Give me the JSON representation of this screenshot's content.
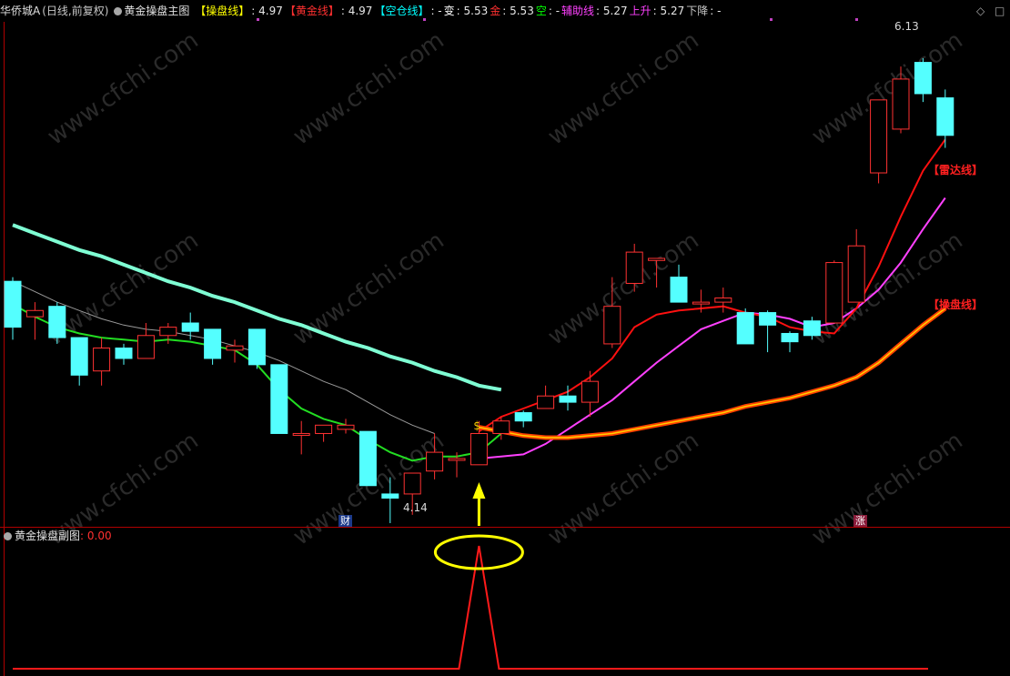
{
  "header": {
    "security": "华侨城A",
    "period": "(日线,前复权)",
    "indicator": "黄金操盘主图",
    "items": [
      {
        "label": "【操盘线】",
        "value": ": 4.97",
        "color": "#ffff00"
      },
      {
        "label": "【黄金线】",
        "value": ": 4.97",
        "color": "#ff3030"
      },
      {
        "label": "【空仓线】",
        "value": ": -",
        "color": "#00ffff"
      },
      {
        "label": "变",
        "value": ": 5.53",
        "color": "#ffffff"
      },
      {
        "label": "金",
        "value": ": 5.53",
        "color": "#ff3030"
      },
      {
        "label": "空",
        "value": ": -",
        "color": "#00ff00"
      },
      {
        "label": "辅助线",
        "value": ": 5.27",
        "color": "#ff40ff"
      },
      {
        "label": "上升",
        "value": ": 5.27",
        "color": "#ff40ff"
      },
      {
        "label": "下降",
        "value": ": -",
        "color": "#c8c8c8"
      }
    ]
  },
  "sub_header": {
    "indicator": "黄金操盘副图",
    "value": ": 0.00",
    "value_color": "#ff3030"
  },
  "labels": {
    "high": "6.13",
    "low": "4.14",
    "cai": "财",
    "zhang": "涨",
    "leida": "【雷达线】",
    "caopan": "【操盘线】"
  },
  "watermark": "www.cfchi.com",
  "icons": {
    "settings": "diamond-icon",
    "menu": "menu-icon",
    "money": "money-bag-icon"
  },
  "colors": {
    "up": "#ff3232",
    "down": "#54ffff",
    "leida": "#ff1010",
    "caopan": "#ff8000",
    "fuzhu": "#ff40ff",
    "green": "#22dd22",
    "yellow": "#ffff00",
    "thick": "#7fffd4",
    "thin": "#9a9a9a"
  },
  "chart_data": {
    "type": "candlestick",
    "price_range": [
      4.0,
      6.2
    ],
    "candles": [
      {
        "open": 5.1,
        "close": 4.88,
        "high": 5.12,
        "low": 4.82
      },
      {
        "open": 4.93,
        "close": 4.96,
        "high": 5.0,
        "low": 4.82
      },
      {
        "open": 4.98,
        "close": 4.83,
        "high": 5.0,
        "low": 4.8
      },
      {
        "open": 4.83,
        "close": 4.65,
        "high": 4.83,
        "low": 4.6
      },
      {
        "open": 4.67,
        "close": 4.78,
        "high": 4.83,
        "low": 4.6
      },
      {
        "open": 4.78,
        "close": 4.73,
        "high": 4.8,
        "low": 4.7
      },
      {
        "open": 4.73,
        "close": 4.84,
        "high": 4.9,
        "low": 4.73
      },
      {
        "open": 4.84,
        "close": 4.88,
        "high": 4.9,
        "low": 4.8
      },
      {
        "open": 4.9,
        "close": 4.86,
        "high": 4.95,
        "low": 4.82
      },
      {
        "open": 4.87,
        "close": 4.73,
        "high": 4.87,
        "low": 4.7
      },
      {
        "open": 4.77,
        "close": 4.79,
        "high": 4.82,
        "low": 4.71
      },
      {
        "open": 4.87,
        "close": 4.7,
        "high": 4.87,
        "low": 4.68
      },
      {
        "open": 4.7,
        "close": 4.37,
        "high": 4.7,
        "low": 4.37
      },
      {
        "open": 4.37,
        "close": 4.37,
        "high": 4.43,
        "low": 4.27
      },
      {
        "open": 4.37,
        "close": 4.41,
        "high": 4.41,
        "low": 4.33
      },
      {
        "open": 4.39,
        "close": 4.41,
        "high": 4.44,
        "low": 4.37
      },
      {
        "open": 4.38,
        "close": 4.12,
        "high": 4.38,
        "low": 4.12
      },
      {
        "open": 4.08,
        "close": 4.06,
        "high": 4.16,
        "low": 3.94
      },
      {
        "open": 4.08,
        "close": 4.18,
        "high": 4.18,
        "low": 3.98
      },
      {
        "open": 4.19,
        "close": 4.28,
        "high": 4.37,
        "low": 4.15
      },
      {
        "open": 4.25,
        "close": 4.25,
        "high": 4.28,
        "low": 4.16
      },
      {
        "open": 4.22,
        "close": 4.37,
        "high": 4.43,
        "low": 4.22
      },
      {
        "open": 4.37,
        "close": 4.43,
        "high": 4.45,
        "low": 4.34
      },
      {
        "open": 4.47,
        "close": 4.43,
        "high": 4.48,
        "low": 4.4
      },
      {
        "open": 4.49,
        "close": 4.55,
        "high": 4.6,
        "low": 4.49
      },
      {
        "open": 4.55,
        "close": 4.52,
        "high": 4.6,
        "low": 4.48
      },
      {
        "open": 4.52,
        "close": 4.62,
        "high": 4.67,
        "low": 4.45
      },
      {
        "open": 4.8,
        "close": 4.98,
        "high": 5.12,
        "low": 4.78
      },
      {
        "open": 5.09,
        "close": 5.24,
        "high": 5.28,
        "low": 5.05
      },
      {
        "open": 5.2,
        "close": 5.21,
        "high": 5.2,
        "low": 5.07
      },
      {
        "open": 5.12,
        "close": 5.0,
        "high": 5.18,
        "low": 5.0
      },
      {
        "open": 5.0,
        "close": 5.0,
        "high": 5.06,
        "low": 4.95
      },
      {
        "open": 5.0,
        "close": 5.02,
        "high": 5.07,
        "low": 4.95
      },
      {
        "open": 4.95,
        "close": 4.8,
        "high": 4.97,
        "low": 4.8
      },
      {
        "open": 4.95,
        "close": 4.89,
        "high": 4.96,
        "low": 4.76
      },
      {
        "open": 4.85,
        "close": 4.81,
        "high": 4.86,
        "low": 4.76
      },
      {
        "open": 4.91,
        "close": 4.84,
        "high": 4.93,
        "low": 4.82
      },
      {
        "open": 4.9,
        "close": 5.19,
        "high": 5.2,
        "low": 4.9
      },
      {
        "open": 5.0,
        "close": 5.27,
        "high": 5.35,
        "low": 5.0
      },
      {
        "open": 5.62,
        "close": 5.97,
        "high": 5.97,
        "low": 5.57
      },
      {
        "open": 5.83,
        "close": 6.07,
        "high": 6.13,
        "low": 5.81
      },
      {
        "open": 6.15,
        "close": 6.0,
        "high": 6.17,
        "low": 5.96
      },
      {
        "open": 5.98,
        "close": 5.8,
        "high": 6.02,
        "low": 5.74
      }
    ],
    "lines": {
      "thick_cyan": [
        5.37,
        5.33,
        5.29,
        5.25,
        5.22,
        5.18,
        5.14,
        5.1,
        5.07,
        5.03,
        5.0,
        4.96,
        4.92,
        4.89,
        4.85,
        4.81,
        4.78,
        4.74,
        4.71,
        4.67,
        4.64,
        4.6,
        4.58
      ],
      "thin_gray": [
        5.1,
        5.05,
        5.0,
        4.96,
        4.92,
        4.89,
        4.87,
        4.86,
        4.84,
        4.82,
        4.79,
        4.76,
        4.72,
        4.67,
        4.62,
        4.58,
        4.52,
        4.46,
        4.41,
        4.37
      ],
      "main": [
        4.99,
        4.93,
        4.88,
        4.85,
        4.83,
        4.82,
        4.81,
        4.82,
        4.81,
        4.79,
        4.77,
        4.7,
        4.58,
        4.49,
        4.44,
        4.41,
        4.34,
        4.28,
        4.24,
        4.26,
        4.26,
        4.28,
        4.37
      ],
      "leida": [
        null,
        null,
        null,
        null,
        null,
        null,
        null,
        null,
        null,
        null,
        null,
        null,
        null,
        null,
        null,
        null,
        null,
        null,
        null,
        null,
        null,
        4.38,
        4.45,
        4.49,
        4.53,
        4.57,
        4.64,
        4.73,
        4.88,
        4.94,
        4.96,
        4.97,
        4.98,
        4.95,
        4.93,
        4.88,
        4.86,
        4.85,
        4.97,
        5.17,
        5.41,
        5.63,
        5.78
      ],
      "fuzhu": [
        null,
        null,
        null,
        null,
        null,
        null,
        null,
        null,
        null,
        null,
        null,
        null,
        null,
        null,
        null,
        null,
        null,
        null,
        null,
        null,
        null,
        4.25,
        4.26,
        4.27,
        4.32,
        4.39,
        4.46,
        4.53,
        4.62,
        4.71,
        4.79,
        4.87,
        4.91,
        4.95,
        4.94,
        4.92,
        4.88,
        4.9,
        4.97,
        5.06,
        5.19,
        5.35,
        5.5
      ],
      "caopan": [
        null,
        null,
        null,
        null,
        null,
        null,
        null,
        null,
        null,
        null,
        null,
        null,
        null,
        null,
        null,
        null,
        null,
        null,
        null,
        null,
        null,
        4.4,
        4.38,
        4.36,
        4.35,
        4.35,
        4.36,
        4.37,
        4.39,
        4.41,
        4.43,
        4.45,
        4.47,
        4.5,
        4.52,
        4.54,
        4.57,
        4.6,
        4.64,
        4.71,
        4.8,
        4.89,
        4.97
      ]
    },
    "signal": {
      "value": 0.0,
      "peak_index": 21,
      "peak_value": 1.0
    }
  }
}
